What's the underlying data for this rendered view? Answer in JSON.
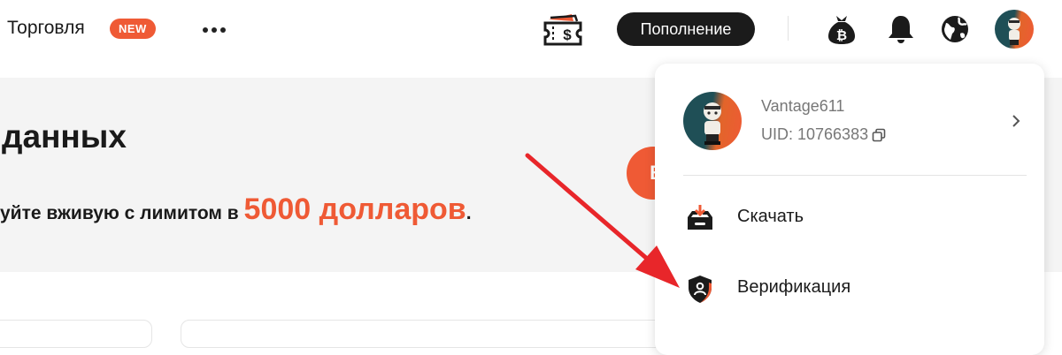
{
  "nav": {
    "trade_label": "Торговля",
    "new_badge": "NEW",
    "deposit_label": "Пополнение"
  },
  "hero": {
    "title": "данных",
    "subtitle_prefix": "уйте вживую с лимитом в ",
    "subtitle_amount": "5000 долларов",
    "subtitle_suffix": ".",
    "circle_letter": "В"
  },
  "profile_menu": {
    "username": "Vantage611",
    "uid": "UID: 10766383",
    "items": [
      {
        "label": "Скачать",
        "icon": "download-tray-icon"
      },
      {
        "label": "Верификация",
        "icon": "shield-user-icon"
      }
    ]
  },
  "colors": {
    "accent": "#ef5a35",
    "dark": "#1b1b1b",
    "hero_bg": "#f4f4f4",
    "arrow": "#e8262a"
  }
}
